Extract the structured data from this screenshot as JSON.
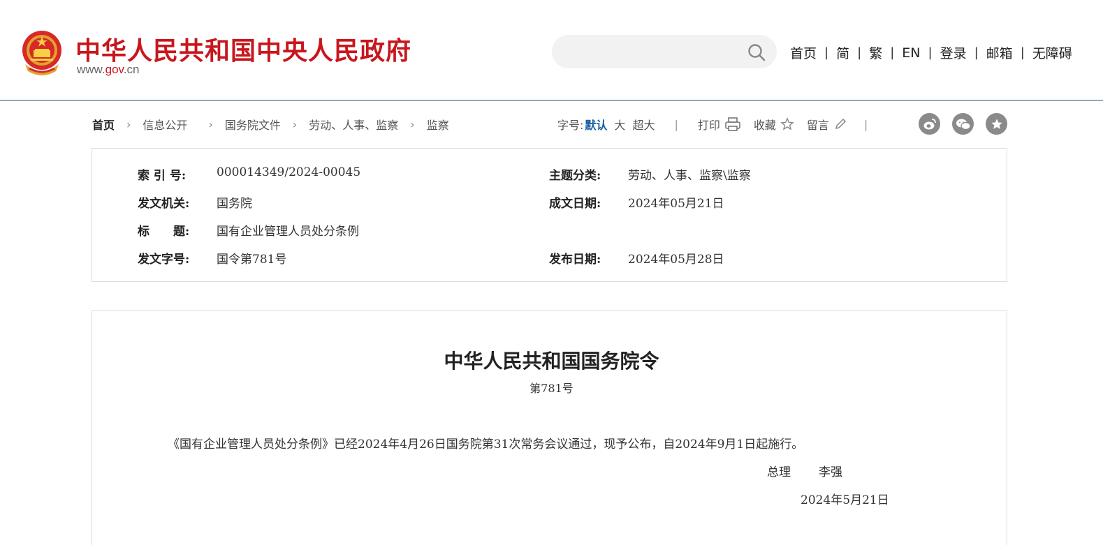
{
  "header": {
    "site_title": "中华人民共和国中央人民政府",
    "url_prefix": "www.",
    "url_mid": "gov",
    "url_suffix": ".cn",
    "search_placeholder": "",
    "nav": [
      "首页",
      "简",
      "繁",
      "EN",
      "登录",
      "邮箱",
      "无障碍"
    ],
    "brand_color": "#c8161d"
  },
  "breadcrumb": [
    "首页",
    "信息公开",
    "国务院文件",
    "劳动、人事、监察",
    "监察"
  ],
  "toolbar": {
    "font_label": "字号:",
    "font_default": "默认",
    "font_large": "大",
    "font_xlarge": "超大",
    "print": "打印",
    "favorite": "收藏",
    "comment": "留言",
    "share_icons": [
      "weibo-icon",
      "wechat-icon",
      "star-circle-icon"
    ]
  },
  "info": {
    "index_label": "索 引 号:",
    "index_value": "000014349/2024-00045",
    "topic_label": "主题分类:",
    "topic_value": "劳动、人事、监察\\监察",
    "issuer_label": "发文机关:",
    "issuer_value": "国务院",
    "written_label": "成文日期:",
    "written_value": "2024年05月21日",
    "title_label": "标　　题:",
    "title_value": "国有企业管理人员处分条例",
    "docno_label": "发文字号:",
    "docno_value": "国令第781号",
    "publish_label": "发布日期:",
    "publish_value": "2024年05月28日"
  },
  "document": {
    "title": "中华人民共和国国务院令",
    "number": "第781号",
    "body": "《国有企业管理人员处分条例》已经2024年4月26日国务院第31次常务会议通过，现予公布，自2024年9月1日起施行。",
    "signer_title": "总理",
    "signer_name": "李强",
    "sign_date": "2024年5月21日"
  }
}
